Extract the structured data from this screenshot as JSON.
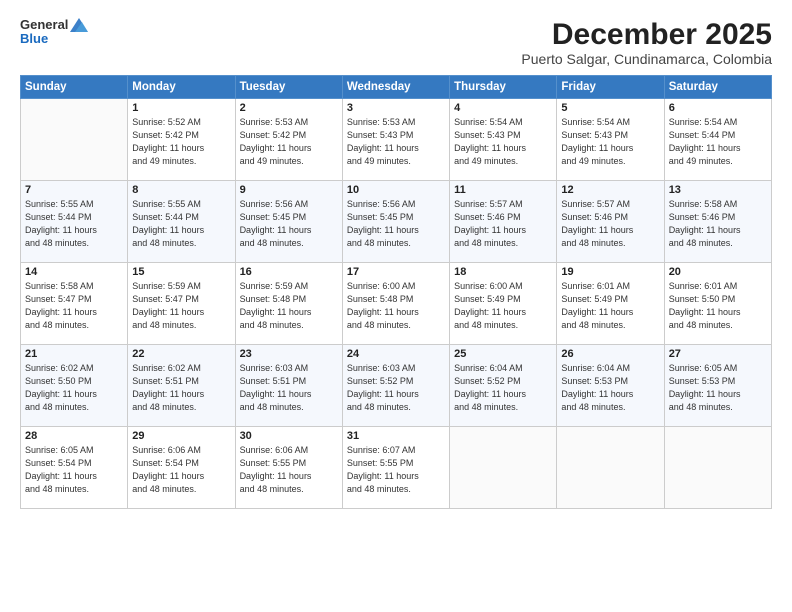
{
  "header": {
    "logo_general": "General",
    "logo_blue": "Blue",
    "month_title": "December 2025",
    "location": "Puerto Salgar, Cundinamarca, Colombia"
  },
  "days_of_week": [
    "Sunday",
    "Monday",
    "Tuesday",
    "Wednesday",
    "Thursday",
    "Friday",
    "Saturday"
  ],
  "weeks": [
    [
      {
        "day": "",
        "info": ""
      },
      {
        "day": "1",
        "info": "Sunrise: 5:52 AM\nSunset: 5:42 PM\nDaylight: 11 hours\nand 49 minutes."
      },
      {
        "day": "2",
        "info": "Sunrise: 5:53 AM\nSunset: 5:42 PM\nDaylight: 11 hours\nand 49 minutes."
      },
      {
        "day": "3",
        "info": "Sunrise: 5:53 AM\nSunset: 5:43 PM\nDaylight: 11 hours\nand 49 minutes."
      },
      {
        "day": "4",
        "info": "Sunrise: 5:54 AM\nSunset: 5:43 PM\nDaylight: 11 hours\nand 49 minutes."
      },
      {
        "day": "5",
        "info": "Sunrise: 5:54 AM\nSunset: 5:43 PM\nDaylight: 11 hours\nand 49 minutes."
      },
      {
        "day": "6",
        "info": "Sunrise: 5:54 AM\nSunset: 5:44 PM\nDaylight: 11 hours\nand 49 minutes."
      }
    ],
    [
      {
        "day": "7",
        "info": "Sunrise: 5:55 AM\nSunset: 5:44 PM\nDaylight: 11 hours\nand 48 minutes."
      },
      {
        "day": "8",
        "info": "Sunrise: 5:55 AM\nSunset: 5:44 PM\nDaylight: 11 hours\nand 48 minutes."
      },
      {
        "day": "9",
        "info": "Sunrise: 5:56 AM\nSunset: 5:45 PM\nDaylight: 11 hours\nand 48 minutes."
      },
      {
        "day": "10",
        "info": "Sunrise: 5:56 AM\nSunset: 5:45 PM\nDaylight: 11 hours\nand 48 minutes."
      },
      {
        "day": "11",
        "info": "Sunrise: 5:57 AM\nSunset: 5:46 PM\nDaylight: 11 hours\nand 48 minutes."
      },
      {
        "day": "12",
        "info": "Sunrise: 5:57 AM\nSunset: 5:46 PM\nDaylight: 11 hours\nand 48 minutes."
      },
      {
        "day": "13",
        "info": "Sunrise: 5:58 AM\nSunset: 5:46 PM\nDaylight: 11 hours\nand 48 minutes."
      }
    ],
    [
      {
        "day": "14",
        "info": "Sunrise: 5:58 AM\nSunset: 5:47 PM\nDaylight: 11 hours\nand 48 minutes."
      },
      {
        "day": "15",
        "info": "Sunrise: 5:59 AM\nSunset: 5:47 PM\nDaylight: 11 hours\nand 48 minutes."
      },
      {
        "day": "16",
        "info": "Sunrise: 5:59 AM\nSunset: 5:48 PM\nDaylight: 11 hours\nand 48 minutes."
      },
      {
        "day": "17",
        "info": "Sunrise: 6:00 AM\nSunset: 5:48 PM\nDaylight: 11 hours\nand 48 minutes."
      },
      {
        "day": "18",
        "info": "Sunrise: 6:00 AM\nSunset: 5:49 PM\nDaylight: 11 hours\nand 48 minutes."
      },
      {
        "day": "19",
        "info": "Sunrise: 6:01 AM\nSunset: 5:49 PM\nDaylight: 11 hours\nand 48 minutes."
      },
      {
        "day": "20",
        "info": "Sunrise: 6:01 AM\nSunset: 5:50 PM\nDaylight: 11 hours\nand 48 minutes."
      }
    ],
    [
      {
        "day": "21",
        "info": "Sunrise: 6:02 AM\nSunset: 5:50 PM\nDaylight: 11 hours\nand 48 minutes."
      },
      {
        "day": "22",
        "info": "Sunrise: 6:02 AM\nSunset: 5:51 PM\nDaylight: 11 hours\nand 48 minutes."
      },
      {
        "day": "23",
        "info": "Sunrise: 6:03 AM\nSunset: 5:51 PM\nDaylight: 11 hours\nand 48 minutes."
      },
      {
        "day": "24",
        "info": "Sunrise: 6:03 AM\nSunset: 5:52 PM\nDaylight: 11 hours\nand 48 minutes."
      },
      {
        "day": "25",
        "info": "Sunrise: 6:04 AM\nSunset: 5:52 PM\nDaylight: 11 hours\nand 48 minutes."
      },
      {
        "day": "26",
        "info": "Sunrise: 6:04 AM\nSunset: 5:53 PM\nDaylight: 11 hours\nand 48 minutes."
      },
      {
        "day": "27",
        "info": "Sunrise: 6:05 AM\nSunset: 5:53 PM\nDaylight: 11 hours\nand 48 minutes."
      }
    ],
    [
      {
        "day": "28",
        "info": "Sunrise: 6:05 AM\nSunset: 5:54 PM\nDaylight: 11 hours\nand 48 minutes."
      },
      {
        "day": "29",
        "info": "Sunrise: 6:06 AM\nSunset: 5:54 PM\nDaylight: 11 hours\nand 48 minutes."
      },
      {
        "day": "30",
        "info": "Sunrise: 6:06 AM\nSunset: 5:55 PM\nDaylight: 11 hours\nand 48 minutes."
      },
      {
        "day": "31",
        "info": "Sunrise: 6:07 AM\nSunset: 5:55 PM\nDaylight: 11 hours\nand 48 minutes."
      },
      {
        "day": "",
        "info": ""
      },
      {
        "day": "",
        "info": ""
      },
      {
        "day": "",
        "info": ""
      }
    ]
  ]
}
